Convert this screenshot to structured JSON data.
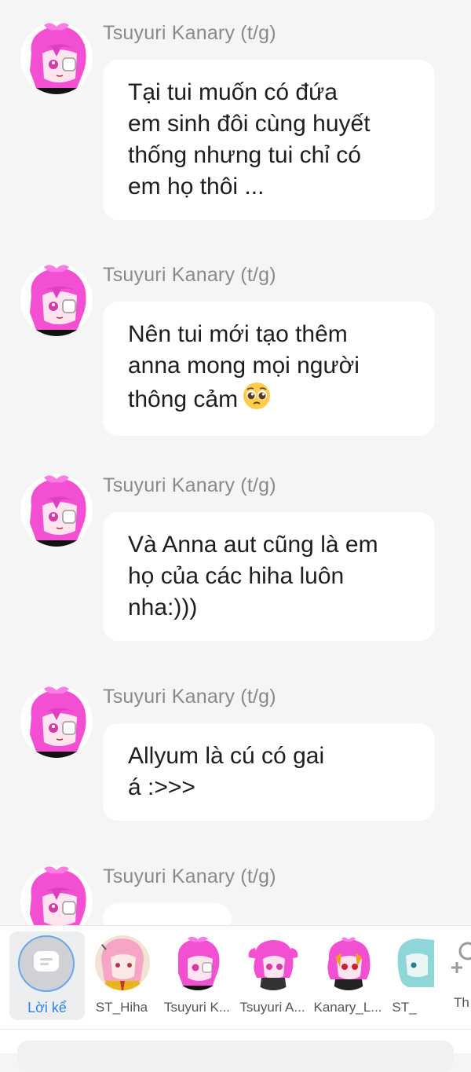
{
  "messages": [
    {
      "sender": "Tsuyuri Kanary (t/g)",
      "lines": [
        "Tại tui muốn có đứa",
        "em sinh đôi cùng huyết",
        "thống nhưng tui chỉ có",
        "em họ thôi ..."
      ]
    },
    {
      "sender": "Tsuyuri Kanary (t/g)",
      "lines": [
        "Nên tui mới tạo thêm",
        "anna mong mọi người",
        "thông cảm"
      ],
      "emoji": "pleading-face-emoji"
    },
    {
      "sender": "Tsuyuri Kanary (t/g)",
      "lines": [
        "Và Anna aut cũng là em",
        "họ của các hiha luôn",
        "nha:)))"
      ]
    },
    {
      "sender": "Tsuyuri Kanary (t/g)",
      "lines": [
        "Allyum là cú có gai",
        "á :>>>"
      ]
    },
    {
      "sender": "Tsuyuri Kanary (t/g)",
      "lines": []
    }
  ],
  "character_bar": {
    "narrator": {
      "label": "Lời kể",
      "icon": "chat-bubble-icon"
    },
    "characters": [
      {
        "label": "ST_Hiha"
      },
      {
        "label": "Tsuyuri K..."
      },
      {
        "label": "Tsuyuri A..."
      },
      {
        "label": "Kanary_L..."
      },
      {
        "label": "ST_"
      }
    ],
    "add": {
      "label": "Th",
      "icon": "add-person-icon"
    }
  },
  "colors": {
    "background": "#f5f5f6",
    "bubble": "#ffffff",
    "sender_name": "#8a8a8a",
    "accent": "#2f80ed",
    "avatar_hair": "#f24fd3"
  }
}
